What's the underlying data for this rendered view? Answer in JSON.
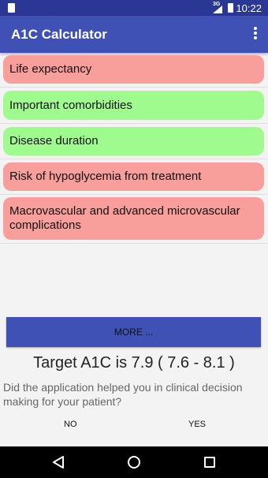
{
  "status_bar": {
    "network": "3G",
    "time": "10:22"
  },
  "app_bar": {
    "title": "A1C Calculator",
    "menu_icon": "more-vert-icon"
  },
  "factors": [
    {
      "label": "Life expectancy",
      "color": "#f89e9b"
    },
    {
      "label": "Important comorbidities",
      "color": "#a0fb8f"
    },
    {
      "label": "Disease duration",
      "color": "#a0fb8f"
    },
    {
      "label": "Risk of hypoglycemia from treatment",
      "color": "#f89e9b"
    },
    {
      "label_line1": "Macrovascular and advanced microvascular",
      "label_line2": "complications",
      "color": "#f89e9b"
    }
  ],
  "more_button": {
    "label": "MORE ..."
  },
  "result": {
    "target_text": "Target A1C is 7.9 ( 7.6 - 8.1 )"
  },
  "feedback": {
    "question": "Did the application helped you in clinical decision making for your patient?",
    "no_label": "NO",
    "yes_label": "YES"
  },
  "colors": {
    "primary": "#3f51b5",
    "primary_dark": "#2a3795",
    "red_factor": "#f89e9b",
    "green_factor": "#a0fb8f"
  }
}
